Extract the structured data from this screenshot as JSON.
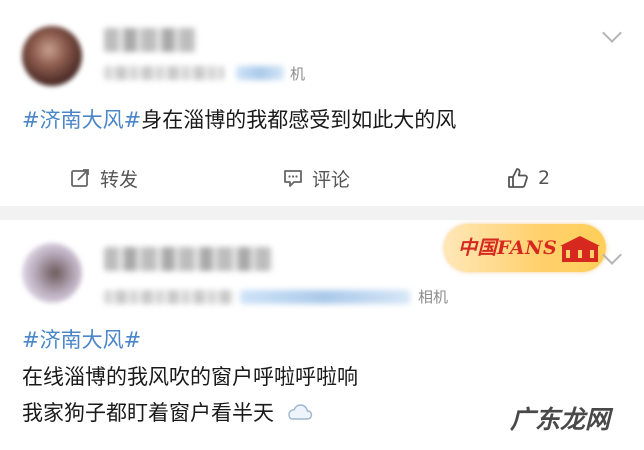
{
  "posts": [
    {
      "source_suffix": "机",
      "topic": "#济南大风#",
      "text_line1": "身在淄博的我都感受到如此大的风",
      "actions": {
        "repost": "转发",
        "comment": "评论",
        "like_count": "2"
      }
    },
    {
      "badge_text": "中国FANS",
      "source_suffix": "相机",
      "topic": "#济南大风#",
      "text_line2": "在线淄博的我风吹的窗户呼啦呼啦响",
      "text_line3": "我家狗子都盯着窗户看半天"
    }
  ],
  "icons": [
    "edit-icon",
    "comment-icon",
    "thumbs-up-icon",
    "chevron-down-icon",
    "cloud-icon",
    "flag-icon"
  ],
  "watermark": "广东龙网",
  "colors": {
    "topic": "#4a86c8",
    "divider": "#f2f2f2",
    "badge": "#ffd06b",
    "badge_text": "#d6281f"
  }
}
